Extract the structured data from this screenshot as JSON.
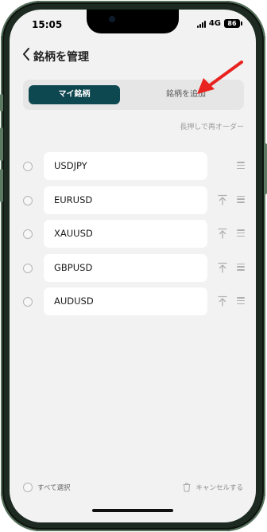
{
  "status_bar": {
    "time": "15:05",
    "network": "4G",
    "battery": "86"
  },
  "header": {
    "back_icon": "chevron-left-icon",
    "title": "銘柄を管理"
  },
  "segment": {
    "active_label": "マイ銘柄",
    "inactive_label": "銘柄を追加",
    "active_color": "#0d4750"
  },
  "hint": "長押しで再オーダー",
  "symbols": [
    {
      "name": "USDJPY",
      "show_pin": false
    },
    {
      "name": "EURUSD",
      "show_pin": true
    },
    {
      "name": "XAUUSD",
      "show_pin": true
    },
    {
      "name": "GBPUSD",
      "show_pin": true
    },
    {
      "name": "AUDUSD",
      "show_pin": true
    }
  ],
  "footer": {
    "select_all_label": "すべて選択",
    "cancel_label": "キャンセルする"
  },
  "annotation": {
    "arrow_color": "#e8231f"
  }
}
